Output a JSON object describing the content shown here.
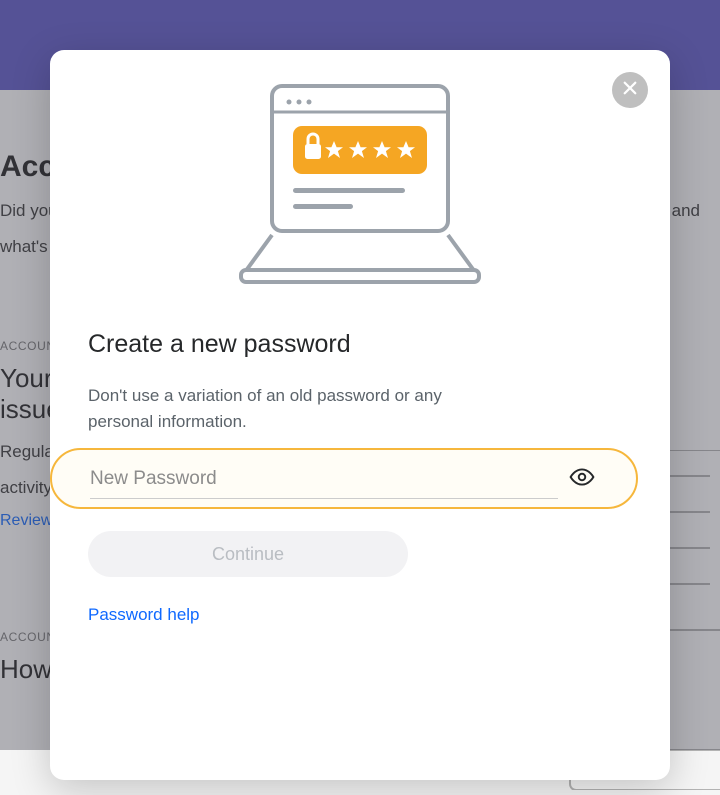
{
  "background": {
    "heading1": "Acco",
    "text1": "Did you",
    "text1b": "look and",
    "text2": "what's",
    "section_label": "ACCOUN",
    "subheading2a": "Your",
    "subheading2b": "issue",
    "body2a": "Regula",
    "body2b": "activity",
    "link2": "Review",
    "section_label2": "ACCOUN",
    "subheading3": "How you sign in to Yahoo"
  },
  "modal": {
    "title": "Create a new password",
    "subtitle": "Don't use a variation of an old password or any personal information.",
    "password_placeholder": "New Password",
    "continue_label": "Continue",
    "help_link": "Password help"
  }
}
